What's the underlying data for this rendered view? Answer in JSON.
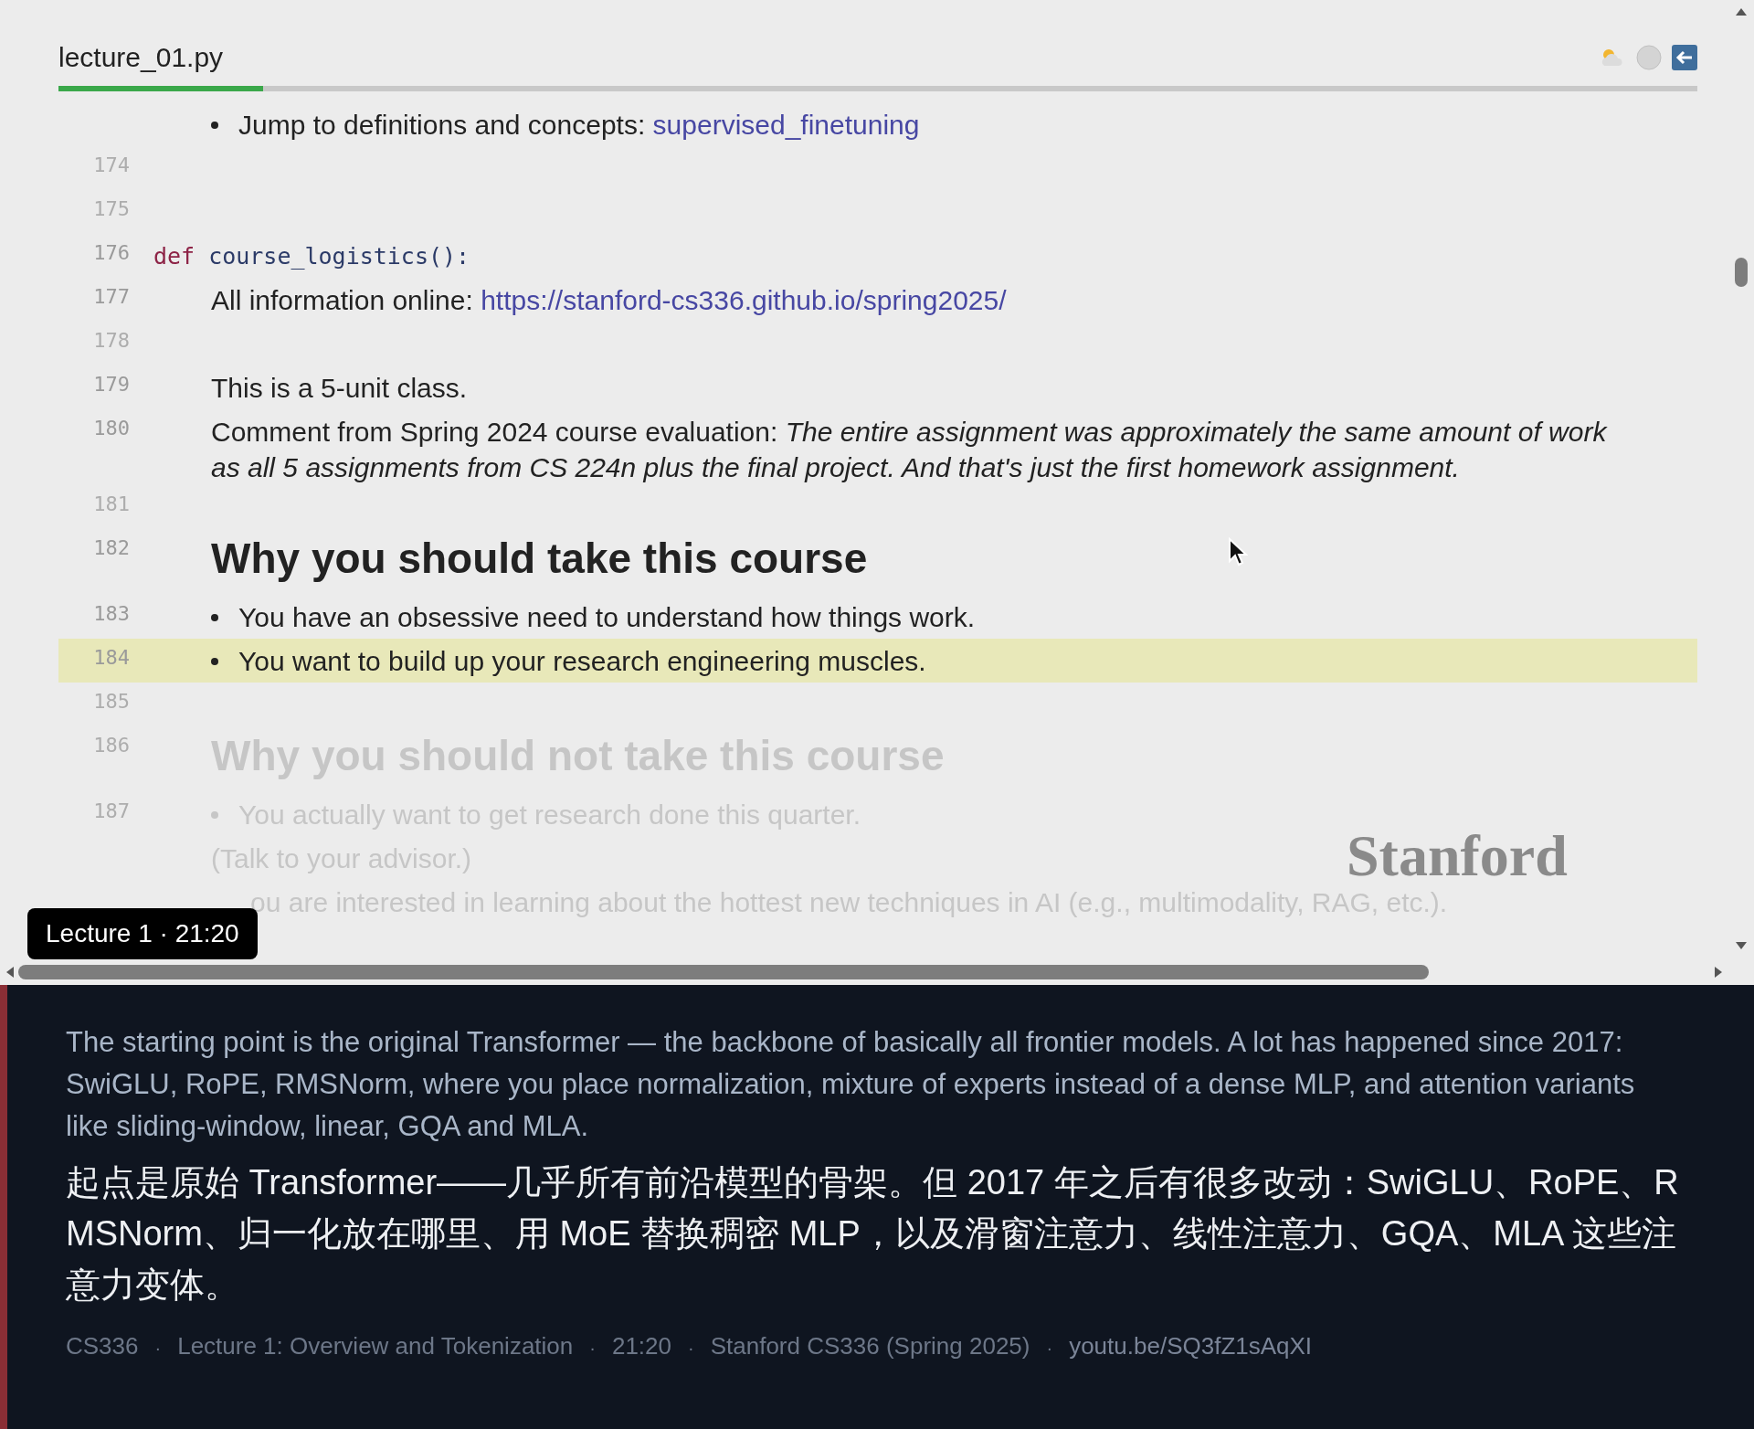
{
  "editor": {
    "tab": {
      "label": "lecture_01.py",
      "selected": true
    },
    "progress": {
      "level": 0.125
    },
    "lines": [
      {
        "kind": "bullet",
        "text": "Jump to definitions and concepts: ",
        "link": "supervised_finetuning",
        "dimmed": false,
        "highlighted": false
      },
      {
        "number": "174",
        "kind": "blank",
        "dimmed": true,
        "highlighted": false
      },
      {
        "number": "175",
        "kind": "blank",
        "dimmed": true,
        "highlighted": false
      },
      {
        "number": "176",
        "kind": "code",
        "keyword": "def",
        "text": "course_logistics():",
        "dimmed": false,
        "highlighted": false
      },
      {
        "number": "177",
        "kind": "text",
        "text": "All information online: ",
        "link": "https://stanford-cs336.github.io/spring2025/",
        "dimmed": false,
        "highlighted": false
      },
      {
        "number": "178",
        "kind": "blank",
        "dimmed": true,
        "highlighted": false
      },
      {
        "number": "179",
        "kind": "text",
        "text": "This is a 5-unit class.",
        "dimmed": false,
        "highlighted": false
      },
      {
        "number": "180",
        "kind": "text",
        "text": "Comment from Spring 2024 course evaluation: *The entire assignment was approximately the same amount of work as all 5 assignments from CS 224n plus the final project. And that's just the first homework assignment.*",
        "dimmed": false,
        "highlighted": false
      },
      {
        "number": "181",
        "kind": "blank",
        "dimmed": true,
        "highlighted": false
      },
      {
        "number": "182",
        "kind": "heading",
        "text": "Why you should take this course",
        "dimmed": false,
        "highlighted": false
      },
      {
        "number": "183",
        "kind": "bullet",
        "text": "You have an obsessive need to understand how things work.",
        "dimmed": false,
        "highlighted": false
      },
      {
        "number": "184",
        "kind": "bullet",
        "text": "You want to build up your research engineering muscles.",
        "dimmed": false,
        "highlighted": true
      },
      {
        "number": "185",
        "kind": "blank",
        "dimmed": true,
        "highlighted": false
      },
      {
        "number": "186",
        "kind": "heading",
        "text": "Why you should not take this course",
        "dimmed": true,
        "highlighted": false
      },
      {
        "number": "187",
        "kind": "bullet",
        "text": "You actually want to get research done this quarter.",
        "dimmed": true,
        "highlighted": false
      },
      {
        "kind": "text",
        "text": "(Talk to your advisor.)",
        "dimmed": true,
        "highlighted": false
      },
      {
        "kind": "partial",
        "text": "ou are interested in learning about the hottest new techniques in AI (e.g., multimodality, RAG, etc.).",
        "dimmed": true,
        "highlighted": false
      }
    ],
    "logo": "Stanford",
    "badge": "Lecture 1 · 21:20"
  },
  "caption": {
    "english": "The starting point is the original Transformer — the backbone of basically all frontier models. A lot has happened since 2017: SwiGLU, RoPE, RMSNorm, where you place normalization, mixture of experts instead of a dense MLP, and attention variants like sliding-window, linear, GQA and MLA.",
    "chinese": "起点是原始 Transformer——几乎所有前沿模型的骨架。但 2017 年之后有很多改动：SwiGLU、RoPE、RMSNorm、归一化放在哪里、用 MoE 替换稠密 MLP，以及滑窗注意力、线性注意力、GQA、MLA 这些注意力变体。",
    "footer": [
      {
        "kind": "item",
        "text": "CS336"
      },
      {
        "kind": "sep",
        "text": "·"
      },
      {
        "kind": "item",
        "text": "Lecture 1: Overview and Tokenization"
      },
      {
        "kind": "sep",
        "text": "·"
      },
      {
        "kind": "item",
        "text": "21:20"
      },
      {
        "kind": "sep",
        "text": "·"
      },
      {
        "kind": "item",
        "text": "Stanford CS336 (Spring 2025)"
      },
      {
        "kind": "sep",
        "text": "·"
      },
      {
        "kind": "link",
        "text": "youtu.be/SQ3fZ1sAqXI"
      }
    ]
  }
}
